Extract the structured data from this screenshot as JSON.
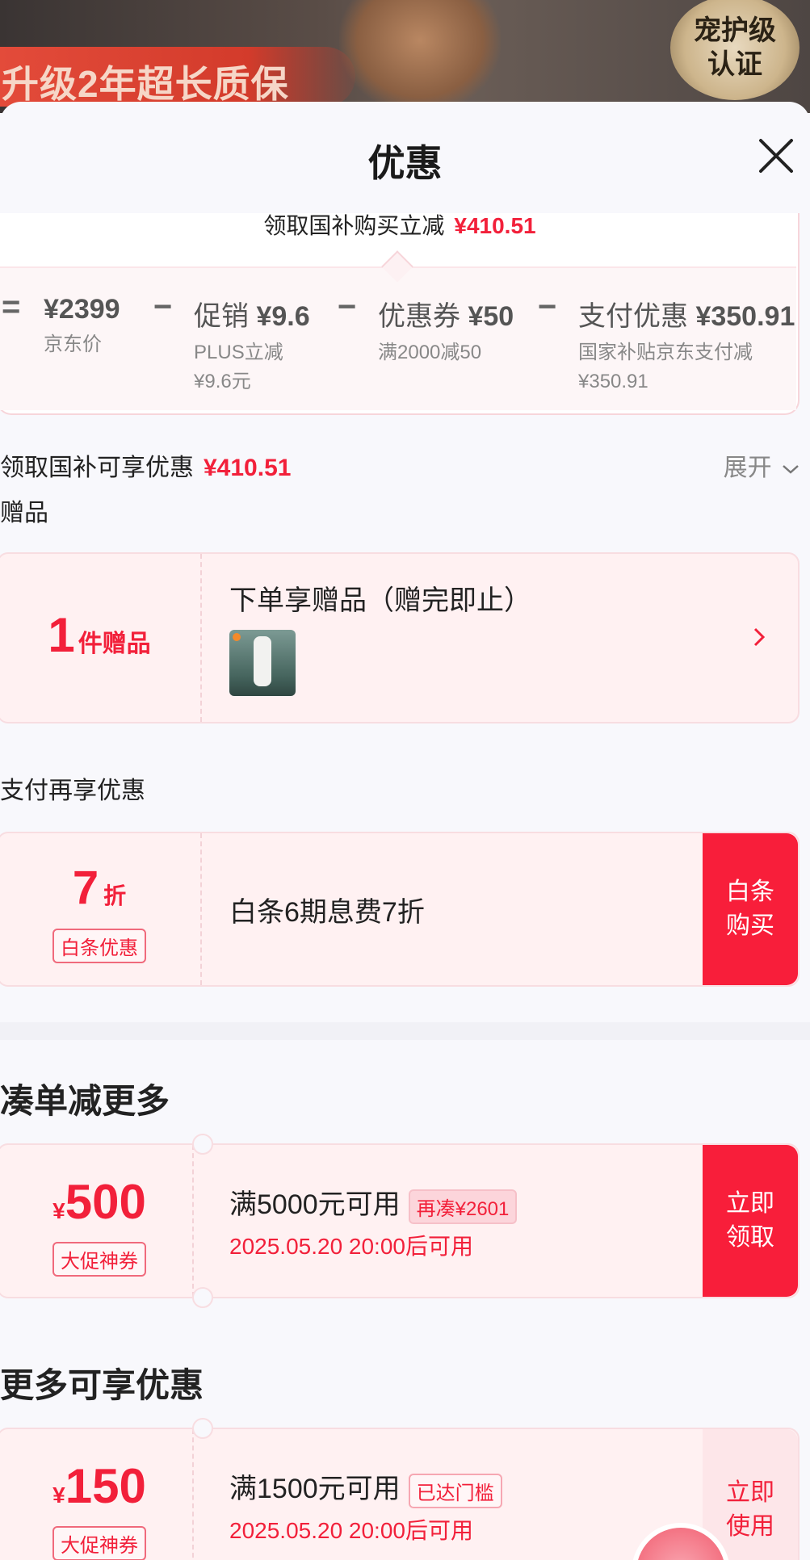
{
  "banner": {
    "ribbon_text": "升级2年超长质保",
    "seal_text": "宠护级认证"
  },
  "sheet": {
    "title": "优惠",
    "close_icon": "close-icon"
  },
  "summary": {
    "head_label": "领取国补购买立减",
    "head_amount": "¥410.51",
    "equals": "=",
    "minus": "−",
    "items": [
      {
        "price": "¥2399",
        "label": "",
        "sub1": "京东价",
        "sub2": ""
      },
      {
        "price": "¥9.6",
        "label": "促销",
        "sub1": "PLUS立减",
        "sub2": "¥9.6元"
      },
      {
        "price": "¥50",
        "label": "优惠券",
        "sub1": "满2000减50",
        "sub2": ""
      },
      {
        "price": "¥350.91",
        "label": "支付优惠",
        "sub1": "国家补贴京东支付减",
        "sub2": "¥350.91"
      }
    ]
  },
  "subsidy_row": {
    "label": "领取国补可享优惠",
    "amount": "¥410.51",
    "expand_label": "展开",
    "expand_icon": "chevron-down-icon"
  },
  "gift_section": {
    "title": "赠品",
    "count": "1",
    "count_unit": "件赠品",
    "headline": "下单享赠品（赠完即止）",
    "arrow_icon": "chevron-right-icon"
  },
  "pay_section": {
    "title": "支付再享优惠",
    "discount": "7",
    "discount_unit": "折",
    "tag": "白条优惠",
    "desc": "白条6期息费7折",
    "button": "白条购买"
  },
  "bundle_section": {
    "title": "凑单减更多",
    "currency": "¥",
    "amount": "500",
    "tag": "大促神券",
    "desc": "满5000元可用",
    "pill": "再凑¥2601",
    "time": "2025.05.20 20:00后可用",
    "button": "立即领取"
  },
  "more_section": {
    "title": "更多可享优惠",
    "currency": "¥",
    "amount": "150",
    "tag": "大促神券",
    "desc": "满1500元可用",
    "pill": "已达门槛",
    "time": "2025.05.20 20:00后可用",
    "button": "立即使用"
  },
  "colors": {
    "accent": "#f2203a",
    "button_red": "#f81e3a",
    "card_bg": "#fff1f2"
  }
}
